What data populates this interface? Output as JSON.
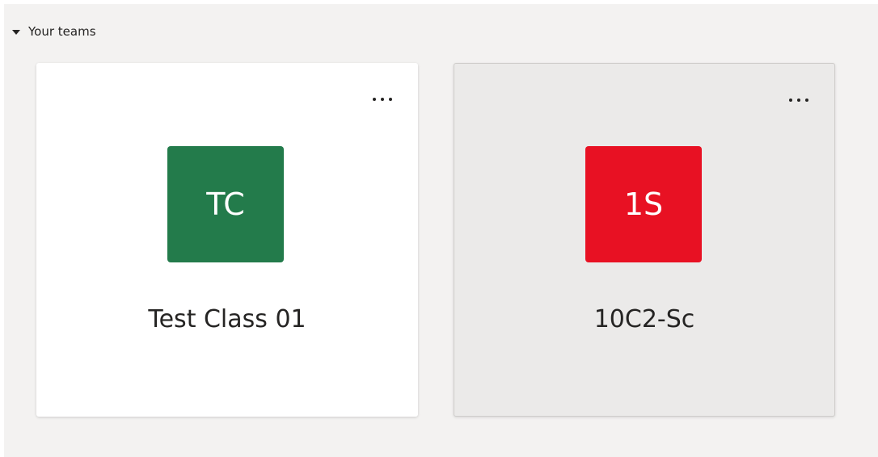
{
  "section": {
    "title": "Your teams",
    "caret_icon": "caret-down-icon"
  },
  "teams": [
    {
      "initials": "TC",
      "name": "Test Class 01",
      "color": "#237b4b",
      "card_style": "white",
      "more_icon": "more-options-icon"
    },
    {
      "initials": "1S",
      "name": "10C2-Sc",
      "color": "#e81123",
      "card_style": "hovered",
      "more_icon": "more-options-icon"
    }
  ]
}
